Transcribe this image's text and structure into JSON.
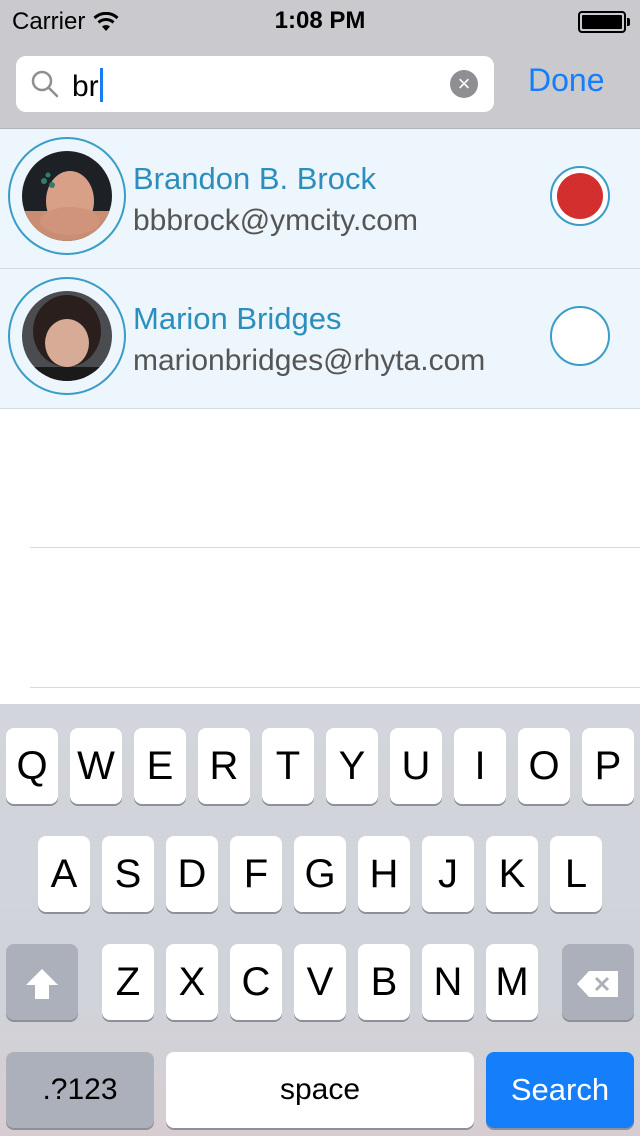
{
  "status_bar": {
    "carrier": "Carrier",
    "time": "1:08 PM"
  },
  "search": {
    "query": "br",
    "done_label": "Done"
  },
  "results": [
    {
      "name": "Brandon B. Brock",
      "email": "bbbrock@ymcity.com",
      "selected": true
    },
    {
      "name": "Marion Bridges",
      "email": "marionbridges@rhyta.com",
      "selected": false
    }
  ],
  "keyboard": {
    "row1": [
      "Q",
      "W",
      "E",
      "R",
      "T",
      "Y",
      "U",
      "I",
      "O",
      "P"
    ],
    "row2": [
      "A",
      "S",
      "D",
      "F",
      "G",
      "H",
      "J",
      "K",
      "L"
    ],
    "row3": [
      "Z",
      "X",
      "C",
      "V",
      "B",
      "N",
      "M"
    ],
    "numbers_label": ".?123",
    "space_label": "space",
    "search_label": "Search"
  },
  "colors": {
    "accent": "#157efb",
    "name_text": "#2b8ebd",
    "row_background": "#edf6fc",
    "selected_dot": "#d42f2f"
  }
}
